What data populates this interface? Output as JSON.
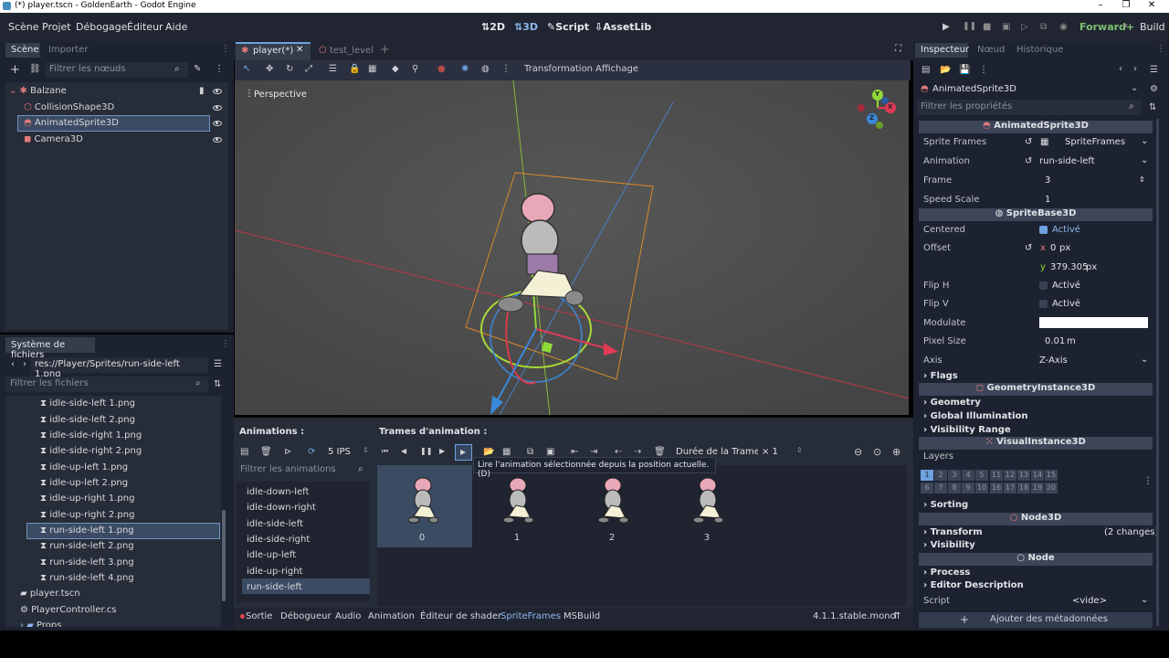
{
  "window": {
    "title": "(*) player.tscn - GoldenEarth - Godot Engine",
    "controls": [
      "–",
      "❐",
      "✕"
    ]
  },
  "menus": [
    "Scène",
    "Projet",
    "Débogage",
    "Éditeur",
    "Aide"
  ],
  "modes": [
    "2D",
    "3D",
    "Script",
    "AssetLib"
  ],
  "renderer": "Forward+",
  "build": "Build",
  "scene_dock": {
    "tabs": [
      "Scène",
      "Importer"
    ],
    "filter_placeholder": "Filtrer les nœuds",
    "nodes": [
      "Balzane",
      "CollisionShape3D",
      "AnimatedSprite3D",
      "Camera3D"
    ]
  },
  "filesystem": {
    "tab": "Système de fichiers",
    "path": "res://Player/Sprites/run-side-left 1.png",
    "filter_placeholder": "Filtrer les fichiers",
    "files": [
      "idle-side-left 1.png",
      "idle-side-left 2.png",
      "idle-side-right 1.png",
      "idle-side-right 2.png",
      "idle-up-left 1.png",
      "idle-up-left 2.png",
      "idle-up-right 1.png",
      "idle-up-right 2.png",
      "run-side-left 1.png",
      "run-side-left 2.png",
      "run-side-left 3.png",
      "run-side-left 4.png",
      "player.tscn",
      "PlayerController.cs",
      "Props"
    ]
  },
  "editor_tabs": [
    "player(*)",
    "test_level"
  ],
  "toolbar": {
    "transform": "Transformation",
    "view": "Affichage"
  },
  "viewport": {
    "label": "Perspective",
    "gizmo": [
      "Y",
      "X",
      "Z"
    ]
  },
  "anim_panel": {
    "title": "Animations :",
    "frames_title": "Trames d'animation :",
    "fps": "5 IPS",
    "filter_placeholder": "Filtrer les animations",
    "animations": [
      "idle-down-left",
      "idle-down-right",
      "idle-side-left",
      "idle-side-right",
      "idle-up-left",
      "idle-up-right",
      "run-side-left"
    ],
    "duration_label": "Durée de la Trame :",
    "duration_value": "× 1",
    "tooltip": "Lire l'animation sélectionnée depuis la position actuelle. (D)",
    "frames": [
      "0",
      "1",
      "2",
      "3"
    ]
  },
  "bottom_tabs": [
    "Sortie",
    "Débogueur",
    "Audio",
    "Animation",
    "Éditeur de shader",
    "SpriteFrames",
    "MSBuild"
  ],
  "version": "4.1.1.stable.mono",
  "inspector": {
    "tabs": [
      "Inspecteur",
      "Nœud",
      "Historique"
    ],
    "node": "AnimatedSprite3D",
    "filter_placeholder": "Filtrer les propriétés",
    "section1": "AnimatedSprite3D",
    "sprite_frames_label": "Sprite Frames",
    "sprite_frames_value": "SpriteFrames",
    "animation_label": "Animation",
    "animation_value": "run-side-left",
    "frame_label": "Frame",
    "frame_value": "3",
    "speed_label": "Speed Scale",
    "speed_value": "1",
    "section2": "SpriteBase3D",
    "centered_label": "Centered",
    "active": "Activé",
    "offset_label": "Offset",
    "offset_x": "0",
    "offset_y": "379.305",
    "px": "px",
    "x": "x",
    "y": "y",
    "fliph_label": "Flip H",
    "flipv_label": "Flip V",
    "modulate_label": "Modulate",
    "pixel_label": "Pixel Size",
    "pixel_value": "0.01",
    "m": "m",
    "axis_label": "Axis",
    "axis_value": "Z-Axis",
    "flags": "Flags",
    "section3": "GeometryInstance3D",
    "geometry": "Geometry",
    "gi": "Global Illumination",
    "vis_range": "Visibility Range",
    "section4": "VisualInstance3D",
    "layers_label": "Layers",
    "layers": [
      "1",
      "2",
      "3",
      "4",
      "5",
      "11",
      "12",
      "13",
      "14",
      "15",
      "6",
      "7",
      "8",
      "9",
      "10",
      "16",
      "17",
      "18",
      "19",
      "20"
    ],
    "sorting": "Sorting",
    "section5": "Node3D",
    "transform": "Transform",
    "changes": "(2 changes)",
    "visibility": "Visibility",
    "section6": "Node",
    "process": "Process",
    "editor_desc": "Editor Description",
    "script_label": "Script",
    "script_value": "<vide>",
    "add_meta": "Ajouter des métadonnées"
  },
  "colors": {
    "accent": "#478cbf",
    "selection": "#3b4b62",
    "panel": "#333b4f"
  }
}
